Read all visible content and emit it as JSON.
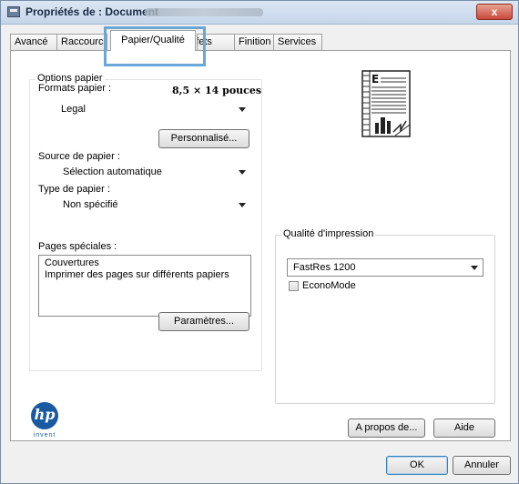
{
  "window": {
    "title": "Propriétés de : Document",
    "close_symbol": "x"
  },
  "tabs": [
    {
      "label": "Avancé"
    },
    {
      "label": "Raccourcis"
    },
    {
      "label": "Papier/Qualité"
    },
    {
      "label": "Effets"
    },
    {
      "label": "Finition"
    },
    {
      "label": "Services"
    }
  ],
  "options_papier": {
    "group_title": "Options papier",
    "formats_label": "Formats papier :",
    "formats_value": "8,5 × 14 pouces",
    "format_selected": "Legal",
    "personnalise_button": "Personnalisé...",
    "source_label": "Source de papier :",
    "source_selected": "Sélection automatique",
    "type_label": "Type de papier :",
    "type_selected": "Non spécifié"
  },
  "pages_speciales": {
    "label": "Pages spéciales :",
    "items": [
      "Couvertures",
      "Imprimer des pages sur différents papiers"
    ],
    "parametres_button": "Paramètres..."
  },
  "qualite": {
    "group_title": "Qualité d'impression",
    "selected": "FastRes 1200",
    "economode_label": "EconoMode",
    "economode_checked": false
  },
  "preview": {
    "icon": "page-preview-icon"
  },
  "footer": {
    "apropos_button": "A propos de...",
    "aide_button": "Aide",
    "ok_button": "OK",
    "annuler_button": "Annuler",
    "logo_text": "hp",
    "logo_subtext": "invent"
  }
}
